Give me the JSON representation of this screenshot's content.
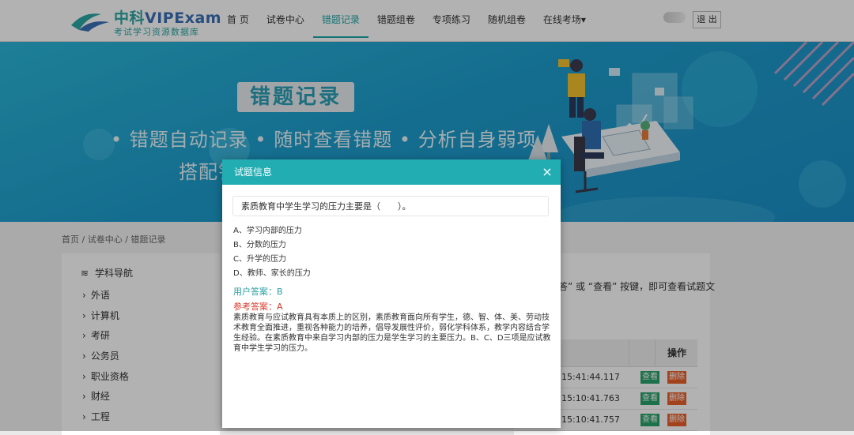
{
  "header": {
    "brand_cn": "中科",
    "brand_en": "VIPExam",
    "tagline": "考试学习资源数据库",
    "nav": [
      "首 页",
      "试卷中心",
      "错题记录",
      "错题组卷",
      "专项练习",
      "随机组卷",
      "在线考场▾"
    ],
    "active_index": 2,
    "logout": "退 出"
  },
  "banner": {
    "title": "错题记录",
    "line1": "• 错题自动记录 • 随时查看错题 • 分析自身弱项",
    "line2": "搭配错"
  },
  "breadcrumb": "首页 / 试卷中心 / 错题记录",
  "sidebar": {
    "title": "学科导航",
    "items": [
      "外语",
      "计算机",
      "考研",
      "公务员",
      "职业资格",
      "财经",
      "工程"
    ]
  },
  "main": {
    "note": "答” 或 “查看” 按键，即可查看试题文",
    "op_header": "操作",
    "rows": [
      {
        "time": "15:41:44.117",
        "view": "查看",
        "del": "删除"
      },
      {
        "time": "15:10:41.763",
        "view": "查看",
        "del": "删除"
      },
      {
        "time": "15:10:41.757",
        "view": "查看",
        "del": "删除"
      }
    ]
  },
  "modal": {
    "title": "试题信息",
    "close": "×",
    "question": "素质教育中学生学习的压力主要是（　　）。",
    "options": [
      "A、学习内部的压力",
      "B、分数的压力",
      "C、升学的压力",
      "D、教师、家长的压力"
    ],
    "user_answer": "用户答案：B",
    "ref_answer": "参考答案：A",
    "analysis": "素质教育与应试教育具有本质上的区别，素质教育面向所有学生，德、智、体、美、劳动技术教育全面推进，重视各种能力的培养，倡导发展性评价，弱化学科体系，教学内容结合学生经验。在素质教育中来自学习内部的压力是学生学习的主要压力。B、C、D三项是应试教育中学生学习的压力。"
  },
  "colors": {
    "accent": "#22adb3",
    "view_button": "#2aa36b",
    "delete_button": "#e8612c",
    "ref_answer": "#d93b2b",
    "user_answer": "#2a9fa0"
  }
}
